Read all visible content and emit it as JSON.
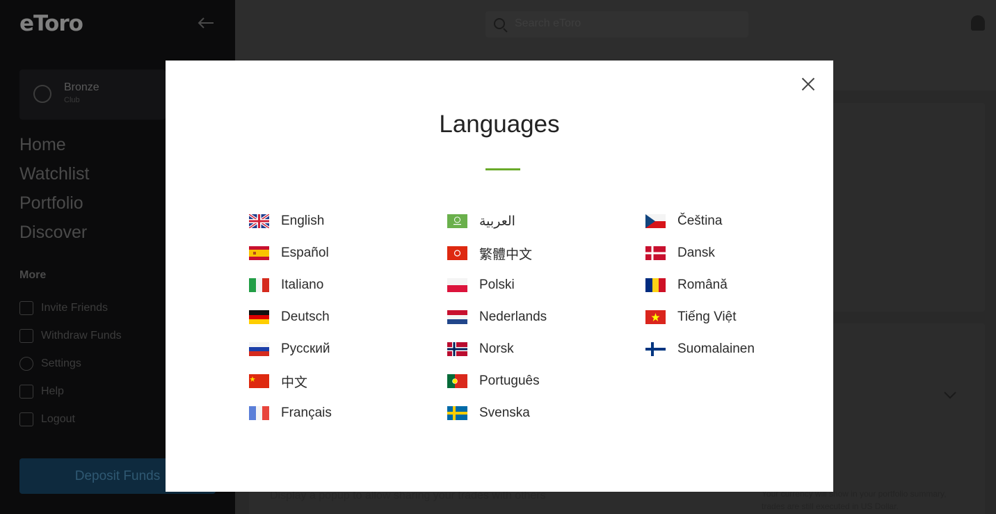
{
  "app": {
    "logo": "eToro",
    "club": {
      "name": "Bronze",
      "sub": "Club"
    },
    "nav_main": [
      "Home",
      "Watchlist",
      "Portfolio",
      "Discover"
    ],
    "more_label": "More",
    "nav_secondary": [
      "Invite Friends",
      "Withdraw Funds",
      "Settings",
      "Help",
      "Logout"
    ],
    "deposit_label": "Deposit Funds",
    "search_placeholder": "Search eToro",
    "footer_left": "Display a popup to allow sharing your trades with others",
    "footer_right": "Your currency will show in your portfolio summary, trades are still executed in US Dollar."
  },
  "modal": {
    "title": "Languages",
    "accent_color": "#6aaa2a",
    "languages": [
      {
        "label": "English",
        "flag": "uk-flag-icon"
      },
      {
        "label": "Español",
        "flag": "spain-flag-icon"
      },
      {
        "label": "Italiano",
        "flag": "italy-flag-icon"
      },
      {
        "label": "Deutsch",
        "flag": "germany-flag-icon"
      },
      {
        "label": "Русский",
        "flag": "russia-flag-icon"
      },
      {
        "label": "中文",
        "flag": "china-flag-icon"
      },
      {
        "label": "Français",
        "flag": "france-flag-icon"
      },
      {
        "label": "العربية",
        "flag": "saudi-flag-icon"
      },
      {
        "label": "繁體中文",
        "flag": "hongkong-flag-icon"
      },
      {
        "label": "Polski",
        "flag": "poland-flag-icon"
      },
      {
        "label": "Nederlands",
        "flag": "netherlands-flag-icon"
      },
      {
        "label": "Norsk",
        "flag": "norway-flag-icon"
      },
      {
        "label": "Português",
        "flag": "portugal-flag-icon"
      },
      {
        "label": "Svenska",
        "flag": "sweden-flag-icon"
      },
      {
        "label": "Čeština",
        "flag": "czech-flag-icon"
      },
      {
        "label": "Dansk",
        "flag": "denmark-flag-icon"
      },
      {
        "label": "Română",
        "flag": "romania-flag-icon"
      },
      {
        "label": "Tiếng Việt",
        "flag": "vietnam-flag-icon"
      },
      {
        "label": "Suomalainen",
        "flag": "finland-flag-icon"
      }
    ]
  }
}
